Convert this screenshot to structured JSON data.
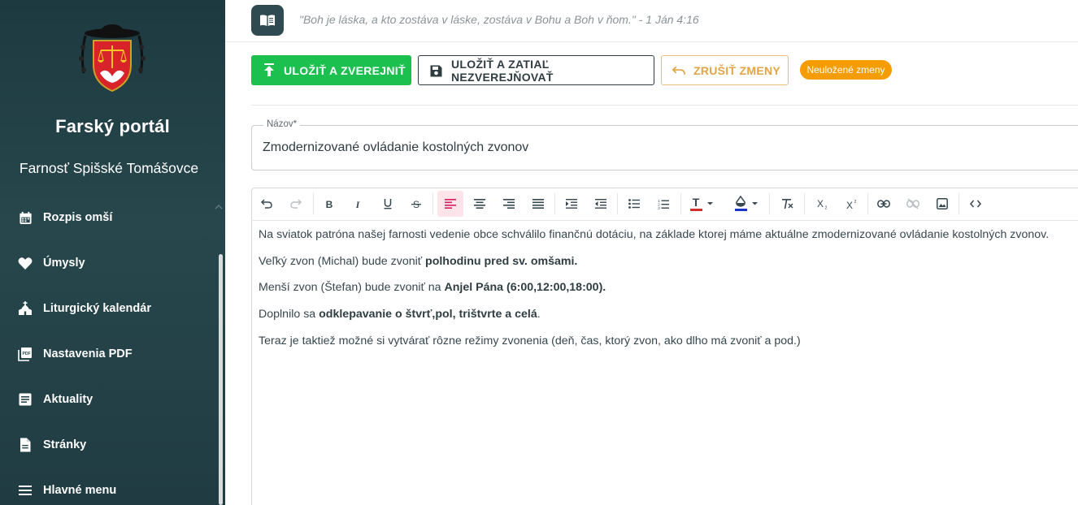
{
  "sidebar": {
    "title": "Farský portál",
    "subtitle": "Farnosť Spišské Tomášovce",
    "items": [
      {
        "label": "Rozpis omší",
        "icon": "calendar-icon"
      },
      {
        "label": "Úmysly",
        "icon": "heart-icon"
      },
      {
        "label": "Liturgický kalendár",
        "icon": "church-icon"
      },
      {
        "label": "Nastavenia PDF",
        "icon": "pdf-icon"
      },
      {
        "label": "Aktuality",
        "icon": "article-icon"
      },
      {
        "label": "Stránky",
        "icon": "page-icon"
      },
      {
        "label": "Hlavné menu",
        "icon": "menu-icon"
      }
    ]
  },
  "header": {
    "quote": "\"Boh je láska, a kto zostáva v láske, zostáva v Bohu a Boh v ňom.\" - 1 Ján 4:16"
  },
  "actions": {
    "publish_label": "ULOŽIŤ A ZVEREJNIŤ",
    "save_label": "ULOŽIŤ A ZATIAĽ NEZVEREJŇOVAŤ",
    "cancel_label": "ZRUŠIŤ ZMENY",
    "status_badge": "Neuložené zmeny"
  },
  "colors": {
    "sidebar_bg": "#27474d",
    "publish": "#1bc04f",
    "cancel": "#e2a444",
    "badge": "#f59c00",
    "active_tool": "#d81b60",
    "text_color_underline": "#d32f2f",
    "highlight_underline": "#1a33c7"
  },
  "form": {
    "title_label": "Názov*",
    "title_value": "Zmodernizované ovládanie kostolných zvonov"
  },
  "editor": {
    "toolbar": [
      "undo-icon",
      "redo-icon",
      "bold-icon",
      "italic-icon",
      "underline-icon",
      "strikethrough-icon",
      "align-left-icon",
      "align-center-icon",
      "align-right-icon",
      "align-justify-icon",
      "indent-icon",
      "outdent-icon",
      "bullet-list-icon",
      "numbered-list-icon",
      "text-color-icon",
      "highlight-color-icon",
      "clear-format-icon",
      "subscript-icon",
      "superscript-icon",
      "link-icon",
      "unlink-icon",
      "image-icon",
      "code-icon"
    ],
    "paragraphs": [
      {
        "plain": "Na sviatok patróna našej farnosti vedenie obce schválilo finančnú dotáciu, na základe ktorej máme aktuálne zmodernizované ovládanie kostolných zvonov."
      },
      {
        "pre": "Veľký zvon (Michal) bude zvoniť ",
        "bold": "polhodinu pred sv. omšami.",
        "post": ""
      },
      {
        "pre": "Menší zvon (Štefan) bude zvoniť na ",
        "bold": "Anjel Pána (6:00,12:00,18:00).",
        "post": ""
      },
      {
        "pre": "Doplnilo sa ",
        "bold": "odklepavanie o štvrť,pol, trištvrte a celá",
        "post": "."
      },
      {
        "plain": "Teraz je taktiež možné si vytvárať rôzne režimy zvonenia (deň, čas, ktorý zvon, ako dlho má zvoniť a pod.)"
      }
    ]
  }
}
